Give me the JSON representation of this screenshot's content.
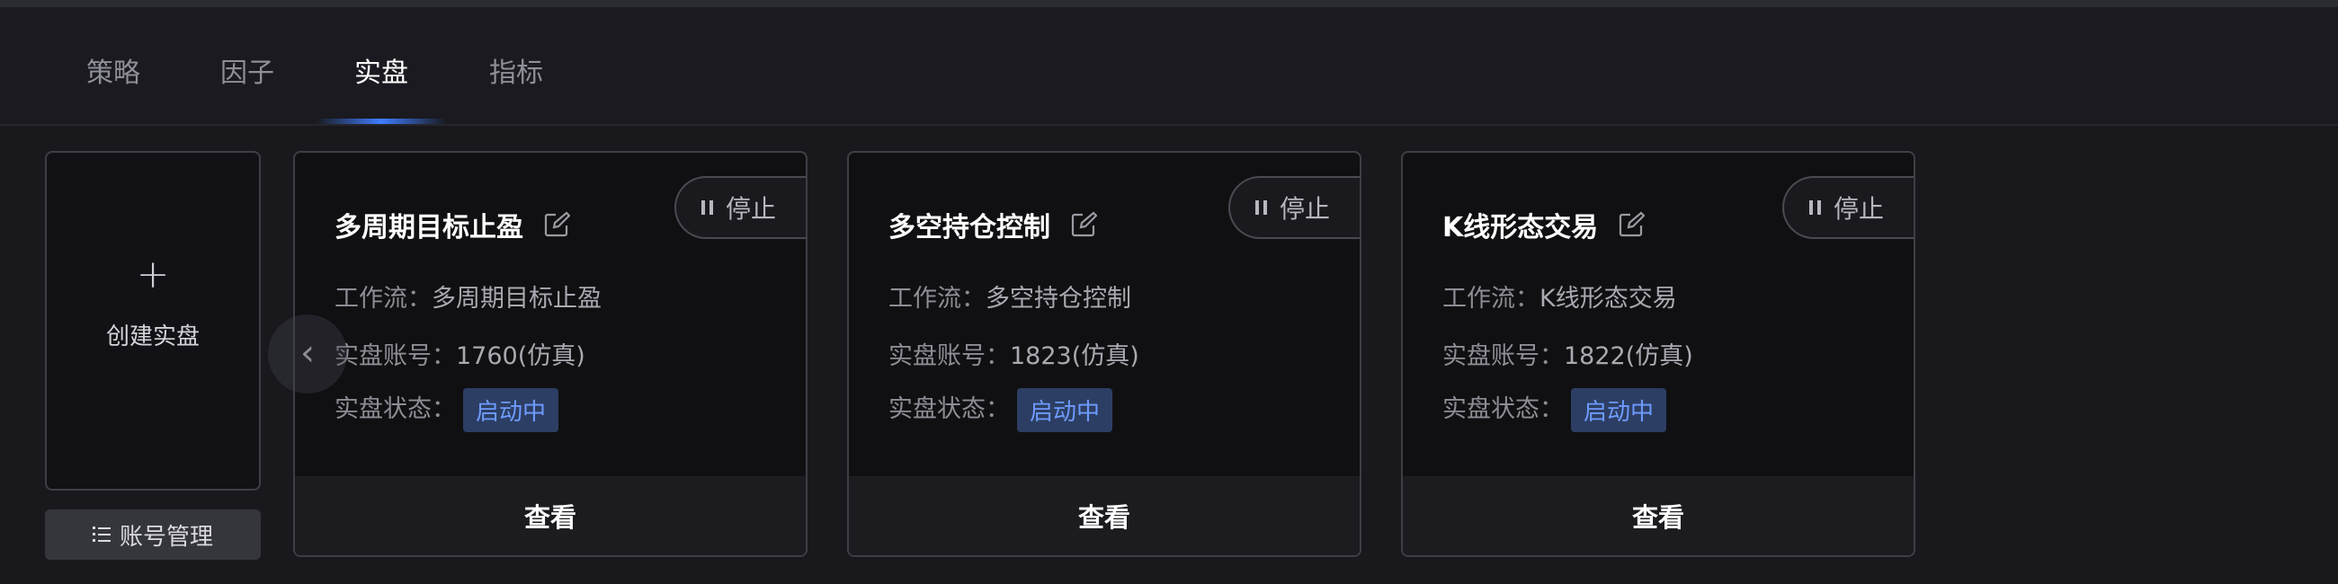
{
  "tabs": [
    {
      "label": "策略",
      "active": false
    },
    {
      "label": "因子",
      "active": false
    },
    {
      "label": "实盘",
      "active": true
    },
    {
      "label": "指标",
      "active": false
    }
  ],
  "sidebar": {
    "create_plus": "+",
    "create_label": "创建实盘",
    "account_label": "账号管理"
  },
  "carousel": {
    "prev_icon": "‹"
  },
  "labels": {
    "workflow": "工作流：",
    "account": "实盘账号：",
    "status": "实盘状态：",
    "stop": "停止",
    "view": "查看"
  },
  "cards": [
    {
      "title": "多周期目标止盈",
      "workflow": "多周期目标止盈",
      "account": "1760(仿真)",
      "status": "启动中"
    },
    {
      "title": "多空持仓控制",
      "workflow": "多空持仓控制",
      "account": "1823(仿真)",
      "status": "启动中"
    },
    {
      "title": "K线形态交易",
      "workflow": "K线形态交易",
      "account": "1822(仿真)",
      "status": "启动中"
    }
  ],
  "colors": {
    "background": "#18181d",
    "accent": "#3f7dff",
    "status_badge_bg": "#2c3e63",
    "status_badge_text": "#6e9bff"
  }
}
